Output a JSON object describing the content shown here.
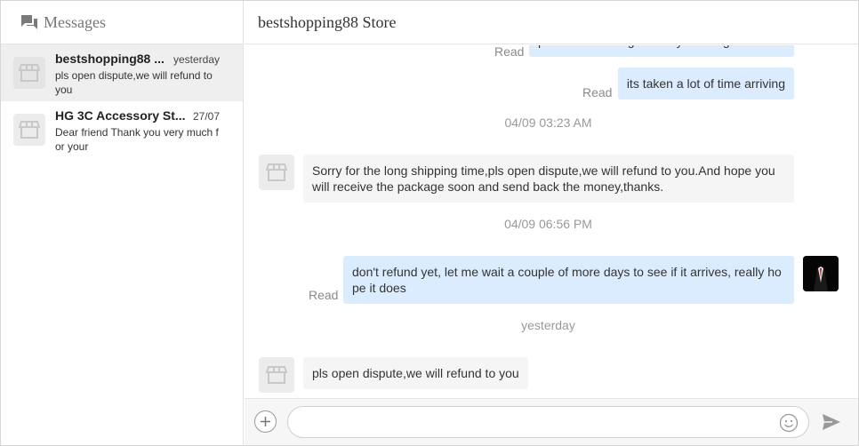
{
  "sidebar": {
    "title": "Messages",
    "icon": "chat-bubbles-icon",
    "conversations": [
      {
        "name": "bestshopping88 ...",
        "time": "yesterday",
        "preview": "pls open dispute,we will refund to you",
        "active": true,
        "avatar_icon": "store-icon"
      },
      {
        "name": "HG 3C Accessory St...",
        "time": "27/07",
        "preview": "Dear friend Thank you very much f or your",
        "active": false,
        "avatar_icon": "store-icon"
      }
    ]
  },
  "chat": {
    "store_name": "bestshopping88 Store",
    "messages": [
      {
        "direction": "out",
        "text": "please I'm having difficulty tracking this order",
        "status": "Read"
      },
      {
        "direction": "out",
        "text": "its taken a lot of time arriving",
        "status": "Read"
      },
      {
        "type": "timestamp",
        "text": "04/09 03:23 AM"
      },
      {
        "direction": "in",
        "text": "Sorry for the long shipping time,pls open dispute,we will refund to you.And hope you will receive the package soon and send back the money,thanks."
      },
      {
        "type": "timestamp",
        "text": "04/09 06:56 PM"
      },
      {
        "direction": "out",
        "text": "don't refund yet, let me wait a couple of more days to see if it arrives, really hope it does",
        "status": "Read"
      },
      {
        "type": "timestamp",
        "text": "yesterday"
      },
      {
        "direction": "in",
        "text": "pls open dispute,we will refund to you"
      }
    ]
  },
  "composer": {
    "placeholder": "",
    "plus_icon": "plus-icon",
    "emoji_icon": "smiley-icon",
    "send_icon": "send-icon"
  },
  "colors": {
    "outgoing_bubble": "#dcecff",
    "incoming_bubble": "#f5f5f5",
    "active_conversation": "#efefef"
  }
}
